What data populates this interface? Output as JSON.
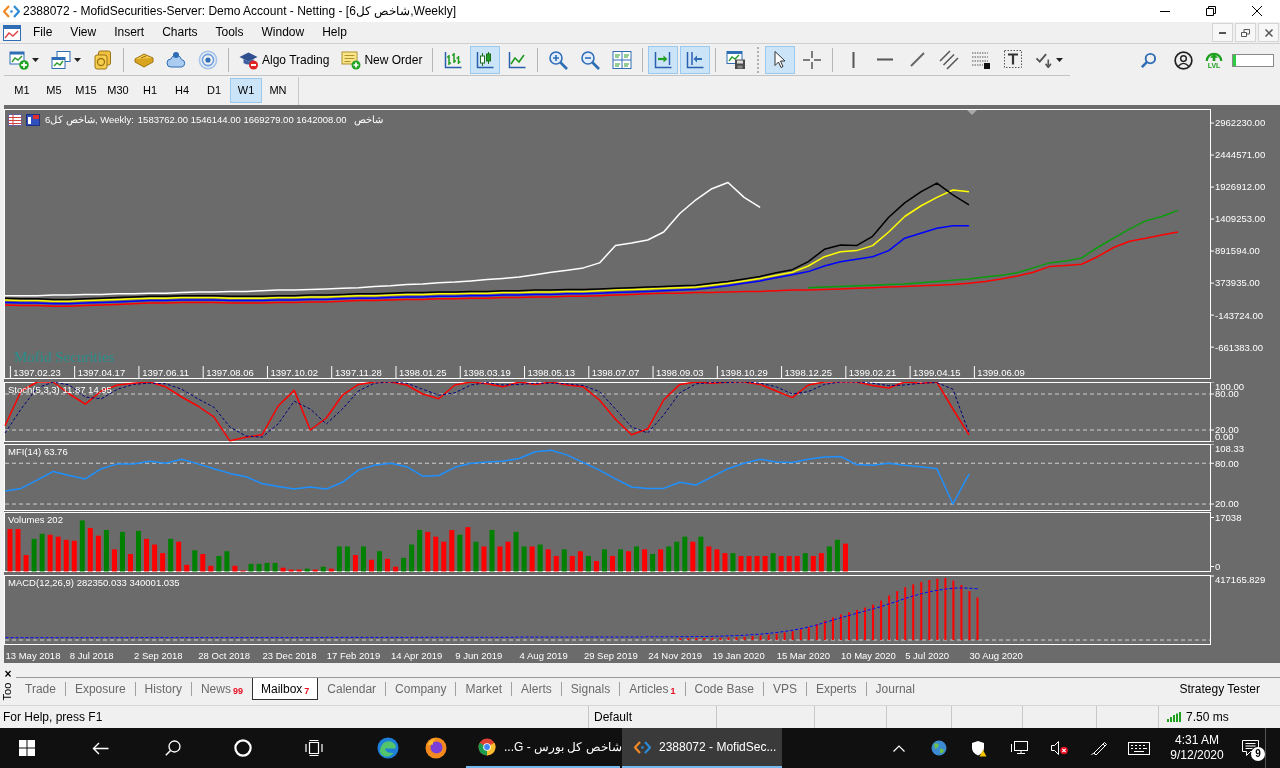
{
  "window": {
    "title": "2388072 - MofidSecurities-Server: Demo Account - Netting - [شاخص کل6,Weekly]"
  },
  "menu": [
    "File",
    "View",
    "Insert",
    "Charts",
    "Tools",
    "Window",
    "Help"
  ],
  "toolbar": [
    {
      "selected": false,
      "dropdown": true
    },
    {
      "selected": false,
      "dropdown": true
    },
    {
      "selected": false
    },
    {
      "selected": false
    },
    {
      "selected": false
    },
    {
      "selected": false
    },
    {
      "label": "Algo Trading",
      "selected": false
    },
    {
      "label": "New Order",
      "selected": false
    },
    {
      "selected": false
    },
    {
      "selected": true
    },
    {
      "selected": false
    },
    {
      "selected": false
    },
    {
      "selected": false
    },
    {
      "selected": false
    },
    {
      "selected": true
    },
    {
      "selected": true
    },
    {
      "selected": false
    },
    {
      "selected": true
    },
    {
      "selected": false
    },
    {
      "selected": false
    },
    {
      "selected": false
    },
    {
      "selected": false
    },
    {
      "selected": false
    },
    {
      "selected": false
    },
    {
      "selected": false
    },
    {
      "selected": false,
      "dropdown": true
    }
  ],
  "toolbar_right": {
    "lvl_label": "LVL",
    "meter": {
      "level": 0.08
    }
  },
  "timeframes": [
    {
      "label": "M1",
      "selected": false
    },
    {
      "label": "M5",
      "selected": false
    },
    {
      "label": "M15",
      "selected": false
    },
    {
      "label": "M30",
      "selected": false
    },
    {
      "label": "H1",
      "selected": false
    },
    {
      "label": "H4",
      "selected": false
    },
    {
      "label": "D1",
      "selected": false
    },
    {
      "label": "W1",
      "selected": true
    },
    {
      "label": "MN",
      "selected": false
    }
  ],
  "chart_window": {
    "header": {
      "symbol": "شاخص کل6, Weekly:",
      "prices": "1583762.00 1546144.00 1669279.00 1642008.00",
      "description": "شاخص"
    },
    "broker_label": "Mofid Securities",
    "main": {
      "chart_data": {
        "type": "line",
        "categories": [
          null,
          null,
          "1397.02.23",
          null,
          null,
          null,
          "1397.04.17",
          null,
          null,
          null,
          "1397.06.11",
          null,
          null,
          null,
          "1397.08.06",
          null,
          null,
          null,
          "1397.10.02",
          null,
          null,
          null,
          "1397.11.28",
          null,
          null,
          null,
          "1398.01.25",
          null,
          null,
          null,
          "1398.03.19",
          null,
          null,
          null,
          "1398.05.13",
          null,
          null,
          null,
          "1398.07.07",
          null,
          null,
          null,
          "1398.09.03",
          null,
          null,
          null,
          "1398.10.29",
          null,
          null,
          null,
          "1398.12.25",
          null,
          null,
          null,
          "1399.02.21",
          null,
          null,
          null,
          "1399.04.15",
          null,
          null,
          null,
          "1399.06.09",
          null,
          null,
          null,
          null,
          null,
          null,
          null,
          null,
          null,
          null,
          null,
          null,
          null
        ],
        "ylim": [
          -1177000,
          3189000
        ],
        "yticks": [
          {
            "value": 2962230,
            "label": "2962230.00"
          },
          {
            "value": 2444571,
            "label": "2444571.00"
          },
          {
            "value": 1926912,
            "label": "1926912.00"
          },
          {
            "value": 1409253,
            "label": "1409253.00"
          },
          {
            "value": 891594,
            "label": "891594.00"
          },
          {
            "value": 373935,
            "label": "373935.00"
          },
          {
            "value": -143724,
            "label": "-143724.00"
          },
          {
            "value": -661383,
            "label": "-661383.00"
          }
        ],
        "series": [
          {
            "color": "#ff0000",
            "values": [
              20000,
              10000,
              10000,
              0,
              0,
              10000,
              20000,
              30000,
              40000,
              50000,
              50000,
              60000,
              60000,
              60000,
              50000,
              50000,
              50000,
              60000,
              60000,
              70000,
              70000,
              80000,
              90000,
              90000,
              100000,
              110000,
              110000,
              120000,
              120000,
              130000,
              130000,
              140000,
              140000,
              150000,
              150000,
              160000,
              160000,
              170000,
              180000,
              190000,
              200000,
              210000,
              210000,
              220000,
              220000,
              230000,
              240000,
              240000,
              250000,
              260000,
              260000,
              270000,
              280000,
              290000,
              300000,
              310000,
              320000,
              330000,
              340000,
              350000,
              370000,
              400000,
              440000,
              490000,
              550000,
              640000,
              660000,
              680000,
              800000,
              950000,
              1050000,
              1100000,
              1150000,
              1200000,
              null,
              null
            ]
          },
          {
            "color": "#0b9b0b",
            "values": [
              null,
              null,
              null,
              null,
              null,
              null,
              null,
              null,
              null,
              null,
              null,
              null,
              null,
              null,
              null,
              null,
              null,
              null,
              null,
              null,
              null,
              null,
              null,
              null,
              null,
              null,
              null,
              null,
              null,
              null,
              null,
              null,
              null,
              null,
              null,
              null,
              null,
              null,
              null,
              null,
              null,
              null,
              null,
              null,
              null,
              null,
              null,
              null,
              null,
              null,
              300000,
              310000,
              320000,
              330000,
              340000,
              350000,
              360000,
              380000,
              400000,
              420000,
              440000,
              470000,
              500000,
              540000,
              620000,
              700000,
              730000,
              780000,
              950000,
              1100000,
              1250000,
              1380000,
              1450000,
              1550000,
              null,
              null
            ]
          },
          {
            "color": "#ffffff",
            "values": [
              170000,
              170000,
              170000,
              180000,
              180000,
              190000,
              190000,
              200000,
              200000,
              210000,
              210000,
              220000,
              230000,
              230000,
              240000,
              240000,
              250000,
              260000,
              260000,
              270000,
              280000,
              290000,
              300000,
              320000,
              330000,
              350000,
              360000,
              380000,
              390000,
              410000,
              430000,
              450000,
              470000,
              510000,
              550000,
              580000,
              620000,
              700000,
              980000,
              1020000,
              1070000,
              1200000,
              1500000,
              1720000,
              1900000,
              2000000,
              1760000,
              1600000,
              null,
              null,
              null,
              null,
              null,
              null,
              null,
              null,
              null,
              null,
              null,
              null,
              null,
              null,
              null,
              null,
              null,
              null,
              null,
              null,
              null,
              null,
              null,
              null,
              null,
              null,
              null,
              null
            ]
          },
          {
            "color": "#0000ff",
            "values": [
              60000,
              50000,
              50000,
              40000,
              40000,
              50000,
              60000,
              70000,
              80000,
              90000,
              90000,
              100000,
              100000,
              100000,
              90000,
              90000,
              90000,
              100000,
              100000,
              110000,
              110000,
              120000,
              130000,
              130000,
              140000,
              150000,
              150000,
              160000,
              160000,
              170000,
              170000,
              180000,
              180000,
              190000,
              190000,
              200000,
              200000,
              210000,
              220000,
              230000,
              240000,
              250000,
              260000,
              270000,
              300000,
              330000,
              370000,
              410000,
              460000,
              510000,
              560000,
              650000,
              720000,
              760000,
              800000,
              900000,
              1100000,
              1180000,
              1260000,
              1300000,
              1300000,
              null,
              null,
              null,
              null,
              null,
              null,
              null,
              null,
              null,
              null,
              null,
              null,
              null,
              null,
              null
            ]
          },
          {
            "color": "#ffff00",
            "values": [
              100000,
              90000,
              90000,
              80000,
              80000,
              90000,
              100000,
              110000,
              120000,
              130000,
              130000,
              140000,
              140000,
              140000,
              130000,
              130000,
              130000,
              140000,
              140000,
              150000,
              150000,
              160000,
              170000,
              170000,
              180000,
              190000,
              190000,
              200000,
              200000,
              210000,
              210000,
              220000,
              220000,
              230000,
              230000,
              240000,
              240000,
              250000,
              260000,
              270000,
              280000,
              290000,
              300000,
              310000,
              340000,
              370000,
              410000,
              450000,
              500000,
              550000,
              650000,
              800000,
              880000,
              900000,
              980000,
              1200000,
              1450000,
              1620000,
              1760000,
              1880000,
              1850000,
              null,
              null,
              null,
              null,
              null,
              null,
              null,
              null,
              null,
              null,
              null,
              null,
              null,
              null,
              null
            ]
          },
          {
            "color": "#000000",
            "values": [
              130000,
              120000,
              120000,
              110000,
              110000,
              120000,
              130000,
              140000,
              150000,
              160000,
              160000,
              170000,
              170000,
              170000,
              160000,
              160000,
              160000,
              170000,
              170000,
              180000,
              180000,
              190000,
              200000,
              200000,
              210000,
              220000,
              220000,
              230000,
              230000,
              240000,
              240000,
              250000,
              250000,
              260000,
              260000,
              270000,
              270000,
              280000,
              290000,
              300000,
              310000,
              320000,
              330000,
              340000,
              370000,
              400000,
              440000,
              480000,
              540000,
              590000,
              720000,
              920000,
              990000,
              980000,
              1130000,
              1440000,
              1670000,
              1850000,
              1990000,
              1800000,
              1640000,
              null,
              null,
              null,
              null,
              null,
              null,
              null,
              null,
              null,
              null,
              null,
              null,
              null,
              null,
              null
            ]
          }
        ]
      }
    },
    "indicators": [
      {
        "kind": "oscillator",
        "label": "Stoch(5,3,3) 11.87 14.95",
        "chart_data": {
          "type": "line",
          "categories": [
            null,
            null,
            null,
            null,
            null,
            null,
            null,
            null,
            null,
            null,
            null,
            null,
            null,
            null,
            null,
            null,
            null,
            null,
            null,
            null,
            null,
            null,
            null,
            null,
            null,
            null,
            null,
            null,
            null,
            null,
            null,
            null,
            null,
            null,
            null,
            null,
            null,
            null,
            null,
            null,
            null,
            null,
            null,
            null,
            null,
            null,
            null,
            null,
            null,
            null,
            null,
            null,
            null,
            null,
            null,
            null,
            null,
            null,
            null,
            null,
            null,
            null,
            null,
            null,
            null,
            null,
            null,
            null,
            null,
            null,
            null,
            null,
            null,
            null,
            null,
            null
          ],
          "ylim": [
            0,
            100
          ],
          "yticks": [
            {
              "value": 100,
              "label": "100.00"
            },
            {
              "value": 80,
              "label": "80.00"
            },
            {
              "value": 20,
              "label": "20.00"
            },
            {
              "value": 0,
              "label": "0.00"
            }
          ],
          "series": [
            {
              "color": "#ff0000",
              "values": [
                27,
                85,
                100,
                100,
                80,
                63,
                85,
                95,
                98,
                100,
                92,
                75,
                60,
                42,
                2,
                8,
                12,
                60,
                86,
                20,
                40,
                78,
                96,
                100,
                100,
                95,
                80,
                72,
                95,
                100,
                97,
                92,
                100,
                96,
                100,
                95,
                92,
                70,
                38,
                12,
                22,
                70,
                96,
                100,
                98,
                100,
                100,
                96,
                85,
                74,
                95,
                100,
                100,
                100,
                94,
                90,
                100,
                98,
                100,
                55,
                12,
                null,
                null,
                null,
                null,
                null,
                null,
                null,
                null,
                null,
                null,
                null,
                null,
                null,
                null,
                null
              ]
            },
            {
              "color": "#000080",
              "line_style": "dashed",
              "values": [
                15,
                55,
                90,
                100,
                95,
                75,
                72,
                88,
                96,
                98,
                97,
                88,
                72,
                58,
                25,
                10,
                8,
                30,
                68,
                55,
                30,
                55,
                85,
                98,
                100,
                98,
                88,
                78,
                82,
                95,
                99,
                95,
                96,
                98,
                98,
                97,
                94,
                84,
                55,
                25,
                15,
                45,
                82,
                97,
                99,
                99,
                100,
                98,
                92,
                80,
                84,
                96,
                100,
                100,
                98,
                94,
                95,
                98,
                99,
                88,
                15,
                null,
                null,
                null,
                null,
                null,
                null,
                null,
                null,
                null,
                null,
                null,
                null,
                null,
                null,
                null
              ]
            }
          ]
        }
      },
      {
        "kind": "oscillator",
        "label": "MFI(14) 63.76",
        "chart_data": {
          "type": "line",
          "categories": [
            null,
            null,
            null,
            null,
            null,
            null,
            null,
            null,
            null,
            null,
            null,
            null,
            null,
            null,
            null,
            null,
            null,
            null,
            null,
            null,
            null,
            null,
            null,
            null,
            null,
            null,
            null,
            null,
            null,
            null,
            null,
            null,
            null,
            null,
            null,
            null,
            null,
            null,
            null,
            null,
            null,
            null,
            null,
            null,
            null,
            null,
            null,
            null,
            null,
            null,
            null,
            null,
            null,
            null,
            null,
            null,
            null,
            null,
            null,
            null,
            null,
            null,
            null,
            null,
            null,
            null,
            null,
            null,
            null,
            null,
            null,
            null,
            null,
            null,
            null,
            null
          ],
          "ylim": [
            9.75,
            108.33
          ],
          "yticks": [
            {
              "value": 108.33,
              "label": "108.33"
            },
            {
              "value": 80,
              "label": "80.00"
            },
            {
              "value": 20,
              "label": "20.00"
            }
          ],
          "series": [
            {
              "color": "#1e90ff",
              "values": [
                39,
                43,
                55,
                68,
                62,
                57,
                72,
                79,
                79,
                83,
                80,
                86,
                79,
                72,
                65,
                60,
                50,
                46,
                42,
                45,
                42,
                52,
                70,
                77,
                80,
                75,
                61,
                62,
                74,
                80,
                82,
                83,
                87,
                97,
                99,
                92,
                81,
                70,
                57,
                45,
                43,
                43,
                52,
                48,
                60,
                72,
                80,
                86,
                82,
                81,
                86,
                89,
                90,
                78,
                77,
                80,
                77,
                75,
                72,
                20,
                64,
                null,
                null,
                null,
                null,
                null,
                null,
                null,
                null,
                null,
                null,
                null,
                null,
                null,
                null,
                null
              ]
            }
          ]
        }
      },
      {
        "kind": "volume_bars",
        "label": "Volumes 202",
        "scale_labels": [
          "17038",
          "0"
        ]
      },
      {
        "kind": "macd",
        "label": "MACD(12,26,9) 282350.033 340001.035",
        "scale_label": "417165.829",
        "time_axis": [
          "13 May 2018",
          "8 Jul 2018",
          "2 Sep 2018",
          "28 Oct 2018",
          "23 Dec 2018",
          "17 Feb 2019",
          "14 Apr 2019",
          "9 Jun 2019",
          "4 Aug 2019",
          "29 Sep 2019",
          "24 Nov 2019",
          "19 Jan 2020",
          "15 Mar 2020",
          "10 May 2020",
          "5 Jul 2020",
          "30 Aug 2020"
        ]
      }
    ]
  },
  "toolbox": {
    "close": "×",
    "title": "Too",
    "tabs": [
      {
        "label": "Trade",
        "selected": false
      },
      {
        "label": "Exposure",
        "selected": false
      },
      {
        "label": "History",
        "selected": false
      },
      {
        "label": "News",
        "badge": "99",
        "selected": false
      },
      {
        "label": "Mailbox",
        "badge": "7",
        "selected": true
      },
      {
        "label": "Calendar",
        "selected": false
      },
      {
        "label": "Company",
        "selected": false
      },
      {
        "label": "Market",
        "selected": false
      },
      {
        "label": "Alerts",
        "selected": false
      },
      {
        "label": "Signals",
        "selected": false
      },
      {
        "label": "Articles",
        "badge": "1",
        "selected": false
      },
      {
        "label": "Code Base",
        "selected": false
      },
      {
        "label": "VPS",
        "selected": false
      },
      {
        "label": "Experts",
        "selected": false
      },
      {
        "label": "Journal",
        "selected": false
      }
    ],
    "strategy_tester": "Strategy Tester"
  },
  "status_bar": {
    "help": "For Help, press F1",
    "profile": "Default",
    "ping": "7.50 ms"
  },
  "taskbar": {
    "windows": [
      {
        "title": "شاخص کل بورس - G...",
        "active": false
      },
      {
        "title": "2388072 - MofidSec...",
        "active": true
      }
    ],
    "time": "4:31 AM",
    "date": "9/12/2020",
    "notifications": "9"
  }
}
